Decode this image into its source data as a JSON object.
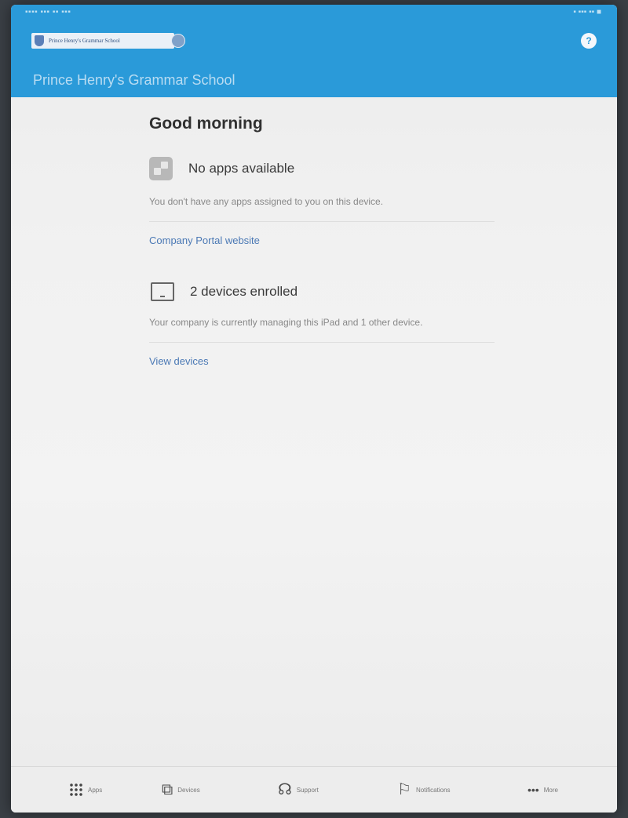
{
  "header": {
    "logo_text": "Prince Henry's Grammar School",
    "school_name": "Prince Henry's Grammar School",
    "help_label": "?"
  },
  "main": {
    "greeting": "Good morning",
    "apps_section": {
      "title": "No apps available",
      "description": "You don't have any apps assigned to you on this device.",
      "link_label": "Company Portal website"
    },
    "devices_section": {
      "title": "2 devices enrolled",
      "description": "Your company is currently managing this iPad and 1 other device.",
      "link_label": "View devices"
    }
  },
  "tabbar": {
    "items": [
      {
        "label": "Apps",
        "icon": "grid-icon"
      },
      {
        "label": "Devices",
        "icon": "devices-icon"
      },
      {
        "label": "Support",
        "icon": "support-icon"
      },
      {
        "label": "Notifications",
        "icon": "flag-icon"
      },
      {
        "label": "More",
        "icon": "more-icon"
      }
    ]
  },
  "colors": {
    "header": "#2a9ad9",
    "link": "#4b79b5",
    "background": "#f1f1f1"
  }
}
